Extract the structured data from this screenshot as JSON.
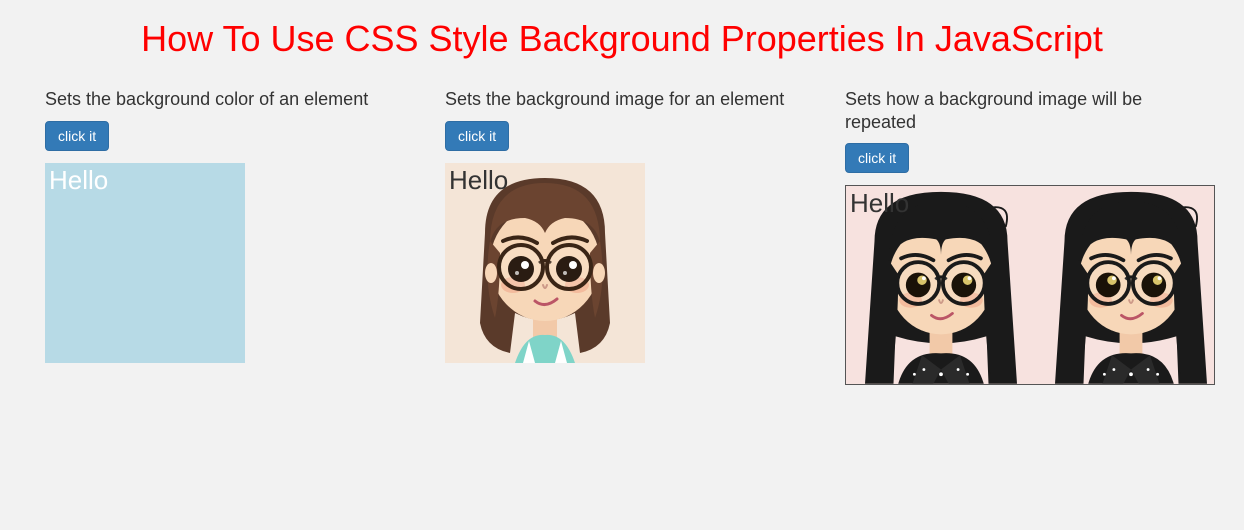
{
  "title": "How To Use CSS Style Background Properties In JavaScript",
  "panels": [
    {
      "desc": "Sets the background color of an element",
      "button": "click it",
      "box_label": "Hello"
    },
    {
      "desc": "Sets the background image for an element",
      "button": "click it",
      "box_label": "Hello"
    },
    {
      "desc": "Sets how a background image will be repeated",
      "button": "click it",
      "box_label": "Hello"
    }
  ]
}
